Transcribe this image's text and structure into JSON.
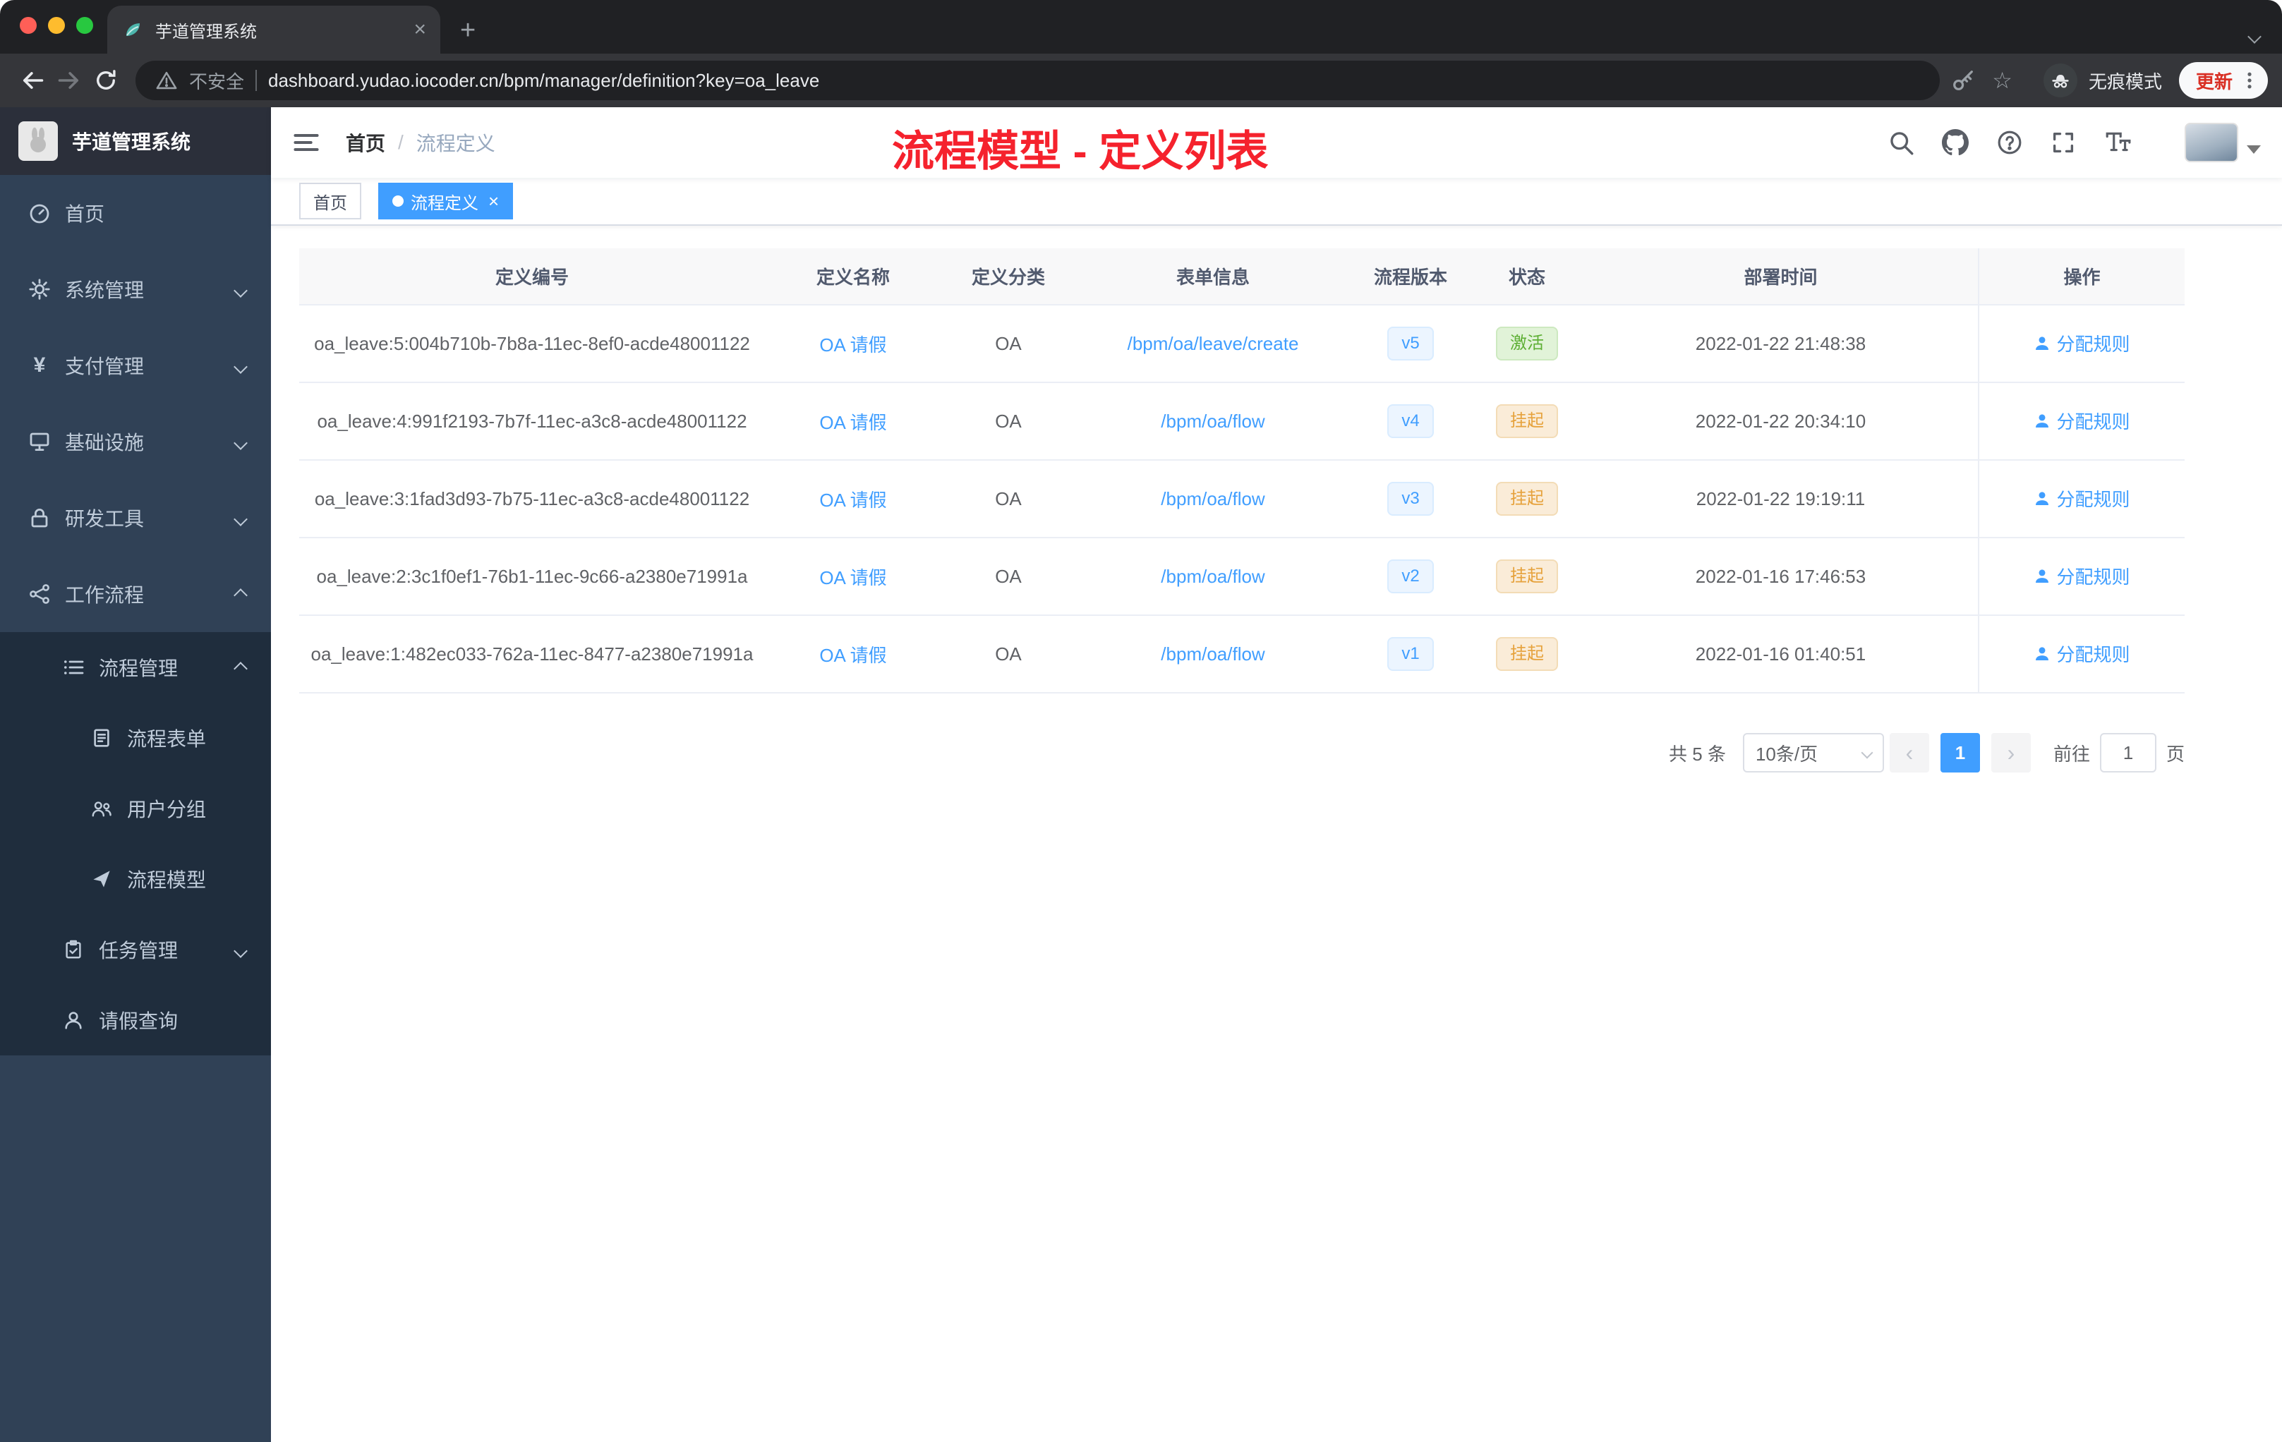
{
  "colors": {
    "accent": "#409eff",
    "success": "#5daf34",
    "warning": "#e6a23c",
    "annotation_red": "#f5222d",
    "sidebar_bg": "#304156",
    "submenu_bg": "#1f2d3d"
  },
  "browser": {
    "tab_title": "芋道管理系统",
    "security_label": "不安全",
    "url": "dashboard.yudao.iocoder.cn/bpm/manager/definition?key=oa_leave",
    "incognito_label": "无痕模式",
    "update_label": "更新"
  },
  "sidebar": {
    "logo_title": "芋道管理系统",
    "items": [
      {
        "label": "首页",
        "icon": "dashboard-icon"
      },
      {
        "label": "系统管理",
        "icon": "gear-icon"
      },
      {
        "label": "支付管理",
        "icon": "yen-icon"
      },
      {
        "label": "基础设施",
        "icon": "infra-icon"
      },
      {
        "label": "研发工具",
        "icon": "tools-icon"
      },
      {
        "label": "工作流程",
        "icon": "workflow-icon"
      }
    ],
    "submenu": [
      {
        "label": "流程管理",
        "icon": "list-icon"
      },
      {
        "label": "流程表单",
        "icon": "form-icon"
      },
      {
        "label": "用户分组",
        "icon": "user-group-icon"
      },
      {
        "label": "流程模型",
        "icon": "send-icon"
      },
      {
        "label": "任务管理",
        "icon": "task-icon"
      },
      {
        "label": "请假查询",
        "icon": "person-icon"
      }
    ]
  },
  "navbar": {
    "breadcrumb_home": "首页",
    "breadcrumb_sep": "/",
    "breadcrumb_current": "流程定义",
    "annotation": "流程模型 - 定义列表"
  },
  "tags": [
    {
      "label": "首页"
    },
    {
      "label": "流程定义"
    }
  ],
  "table": {
    "columns": [
      "定义编号",
      "定义名称",
      "定义分类",
      "表单信息",
      "流程版本",
      "状态",
      "部署时间",
      "操作"
    ],
    "rows": [
      {
        "id": "oa_leave:5:004b710b-7b8a-11ec-8ef0-acde48001122",
        "name": "OA 请假",
        "category": "OA",
        "form": "/bpm/oa/leave/create",
        "version": "v5",
        "status": "激活",
        "status_type": "success",
        "time": "2022-01-22 21:48:38",
        "action": "分配规则"
      },
      {
        "id": "oa_leave:4:991f2193-7b7f-11ec-a3c8-acde48001122",
        "name": "OA 请假",
        "category": "OA",
        "form": "/bpm/oa/flow",
        "version": "v4",
        "status": "挂起",
        "status_type": "warning",
        "time": "2022-01-22 20:34:10",
        "action": "分配规则"
      },
      {
        "id": "oa_leave:3:1fad3d93-7b75-11ec-a3c8-acde48001122",
        "name": "OA 请假",
        "category": "OA",
        "form": "/bpm/oa/flow",
        "version": "v3",
        "status": "挂起",
        "status_type": "warning",
        "time": "2022-01-22 19:19:11",
        "action": "分配规则"
      },
      {
        "id": "oa_leave:2:3c1f0ef1-76b1-11ec-9c66-a2380e71991a",
        "name": "OA 请假",
        "category": "OA",
        "form": "/bpm/oa/flow",
        "version": "v2",
        "status": "挂起",
        "status_type": "warning",
        "time": "2022-01-16 17:46:53",
        "action": "分配规则"
      },
      {
        "id": "oa_leave:1:482ec033-762a-11ec-8477-a2380e71991a",
        "name": "OA 请假",
        "category": "OA",
        "form": "/bpm/oa/flow",
        "version": "v1",
        "status": "挂起",
        "status_type": "warning",
        "time": "2022-01-16 01:40:51",
        "action": "分配规则"
      }
    ]
  },
  "pagination": {
    "total": "共 5 条",
    "page_size": "10条/页",
    "page": "1",
    "goto_label": "前往",
    "goto_value": "1",
    "goto_unit": "页"
  }
}
